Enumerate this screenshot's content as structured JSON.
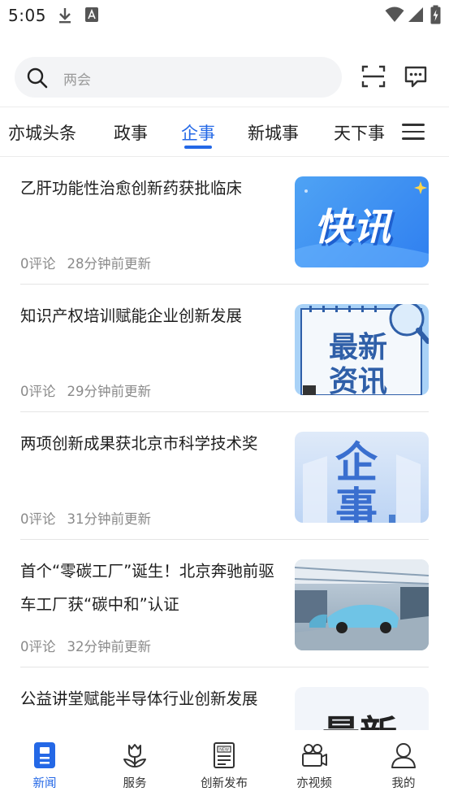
{
  "status": {
    "time": "5:05"
  },
  "search": {
    "placeholder": "两会"
  },
  "tabs": [
    {
      "label": "亦城头条"
    },
    {
      "label": "政事"
    },
    {
      "label": "企事"
    },
    {
      "label": "新城事"
    },
    {
      "label": "天下事"
    }
  ],
  "active_tab": "企事",
  "news": [
    {
      "title": "乙肝功能性治愈创新药获批临床",
      "comments": "0评论",
      "time": "28分钟前更新",
      "thumb_text": "快讯"
    },
    {
      "title": "知识产权培训赋能企业创新发展",
      "comments": "0评论",
      "time": "29分钟前更新",
      "thumb_text_1": "最新",
      "thumb_text_2": "资讯"
    },
    {
      "title": "两项创新成果获北京市科学技术奖",
      "comments": "0评论",
      "time": "31分钟前更新",
      "thumb_text_1": "企",
      "thumb_text_2": "事"
    },
    {
      "title": "首个“零碳工厂”诞生！北京奔驰前驱车工厂获“碳中和”认证",
      "comments": "0评论",
      "time": "32分钟前更新"
    },
    {
      "title": "公益讲堂赋能半导体行业创新发展",
      "thumb_text": "最新"
    }
  ],
  "bottom_nav": [
    {
      "label": "新闻"
    },
    {
      "label": "服务"
    },
    {
      "label": "创新发布"
    },
    {
      "label": "亦视频"
    },
    {
      "label": "我的"
    }
  ],
  "colors": {
    "accent": "#2468e6",
    "text": "#1e1e1e",
    "meta": "#8a8a8a"
  }
}
